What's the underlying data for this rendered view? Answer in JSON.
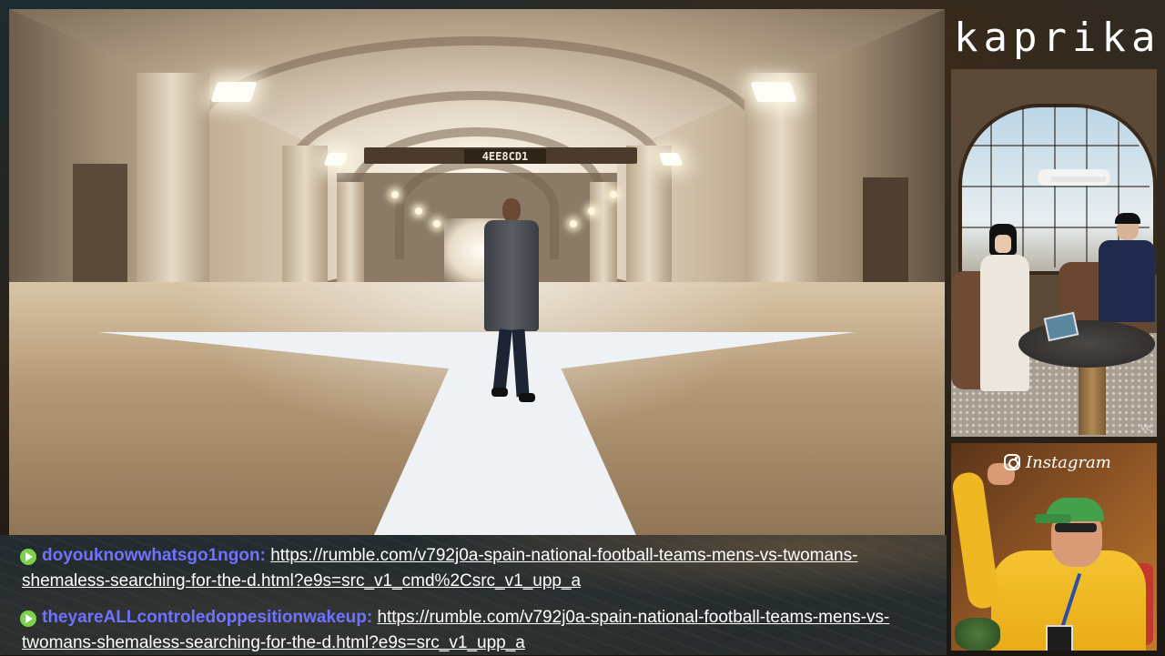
{
  "brand": {
    "name": "kaprika"
  },
  "main_video": {
    "sign_text": "4EE8CD1"
  },
  "side_thumbs": {
    "top_watermark": "Ve",
    "bottom_label": "Instagram"
  },
  "chat": {
    "messages": [
      {
        "username": "doyouknowwhatsgo1ngon:",
        "text": "https://rumble.com/v792j0a-spain-national-football-teams-mens-vs-twomans-shemaless-searching-for-the-d.html?e9s=src_v1_cmd%2Csrc_v1_upp_a"
      },
      {
        "username": "theyareALLcontroledoppesitionwakeup:",
        "text": "https://rumble.com/v792j0a-spain-national-football-teams-mens-vs-twomans-shemaless-searching-for-the-d.html?e9s=src_v1_upp_a"
      }
    ]
  },
  "colors": {
    "username": "#6f73ff",
    "play_badge": "#7bd34b",
    "accent_text": "#ffffff"
  },
  "icons": [
    "play-badge-icon",
    "instagram-icon"
  ]
}
